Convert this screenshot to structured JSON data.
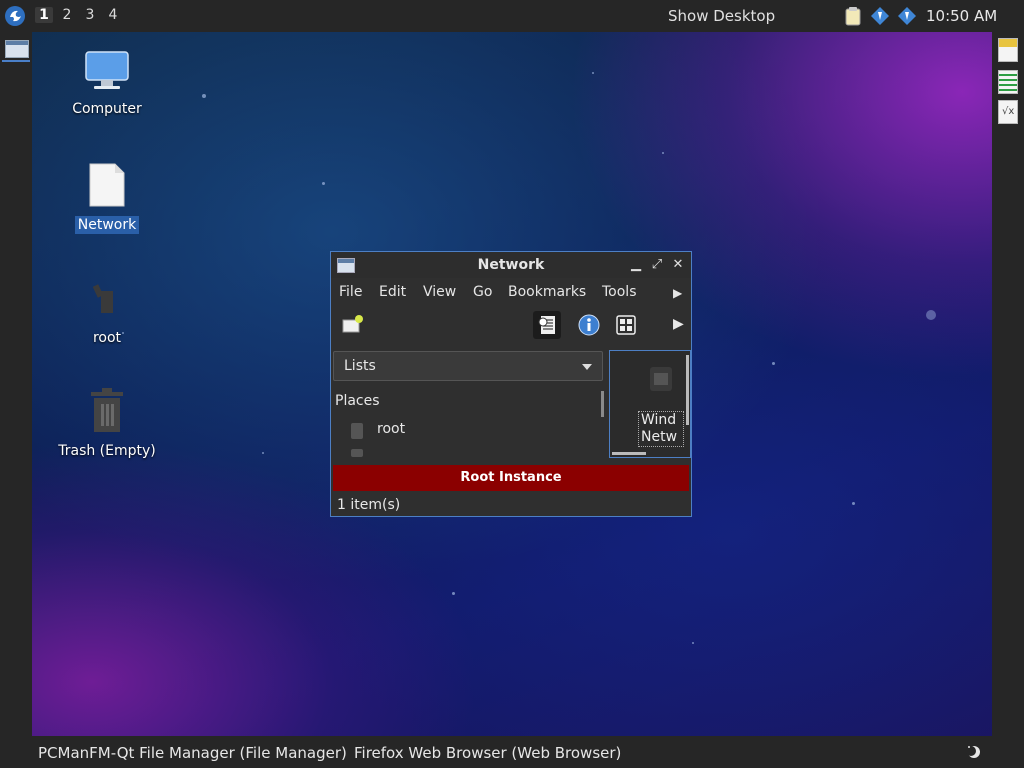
{
  "top_panel": {
    "workspaces": [
      "1",
      "2",
      "3",
      "4"
    ],
    "active_workspace": "1",
    "show_desktop": "Show Desktop",
    "tray_icons": [
      "clipboard-icon",
      "network-icon",
      "network-icon"
    ],
    "clock": "10:50 AM"
  },
  "right_strip": {
    "icons": [
      "qt-doc-icon",
      "spreadsheet-icon",
      "formula-doc-icon"
    ]
  },
  "desktop": {
    "icons": [
      {
        "label": "Computer",
        "icon": "computer-icon",
        "selected": false
      },
      {
        "label": "Network",
        "icon": "file-icon",
        "selected": true
      },
      {
        "label": "root",
        "icon": "home-folder-icon",
        "selected": false
      },
      {
        "label": "Trash (Empty)",
        "icon": "trash-icon",
        "selected": false
      }
    ]
  },
  "file_manager": {
    "title": "Network",
    "menu": [
      "File",
      "Edit",
      "View",
      "Go",
      "Bookmarks",
      "Tools"
    ],
    "side_panel": {
      "mode": "Lists",
      "section": "Places",
      "items": [
        "root"
      ]
    },
    "view_item": {
      "line1": "Wind",
      "line2": "Netw"
    },
    "banner": "Root Instance",
    "status": "1 item(s)"
  },
  "taskbar": {
    "tasks": [
      "PCManFM-Qt File Manager (File Manager)",
      "Firefox Web Browser (Web Browser)"
    ]
  },
  "colors": {
    "panel": "#262626",
    "selection": "#2a5fa8",
    "root_banner": "#8b0000",
    "window_border": "#4d7fc4"
  }
}
